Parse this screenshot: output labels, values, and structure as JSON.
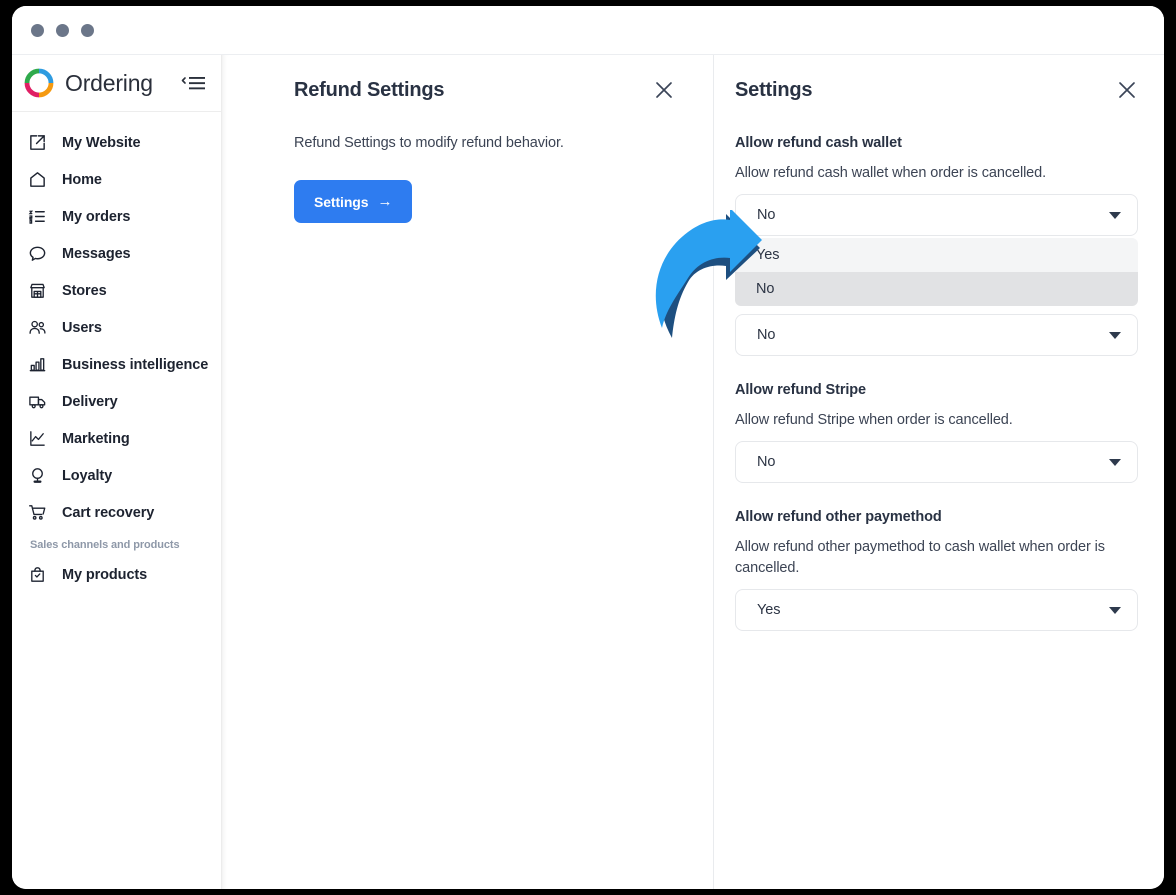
{
  "window": {
    "traffic_dots": [
      "dot-1",
      "dot-2",
      "dot-3"
    ]
  },
  "sidebar": {
    "brand": "Ordering",
    "logo_icon": "ordering-ring-logo",
    "logo_colors": [
      "#2faa4c",
      "#2e9be0",
      "#f59a11",
      "#e01f64"
    ],
    "collapse_icon": "collapse-sidebar-icon",
    "items": [
      {
        "label": "My Website",
        "icon": "external-link-icon"
      },
      {
        "label": "Home",
        "icon": "home-icon"
      },
      {
        "label": "My orders",
        "icon": "ordered-list-icon"
      },
      {
        "label": "Messages",
        "icon": "chat-bubble-icon"
      },
      {
        "label": "Stores",
        "icon": "store-icon"
      },
      {
        "label": "Users",
        "icon": "users-icon"
      },
      {
        "label": "Business intelligence",
        "icon": "bar-chart-icon"
      },
      {
        "label": "Delivery",
        "icon": "truck-icon"
      },
      {
        "label": "Marketing",
        "icon": "line-chart-icon"
      },
      {
        "label": "Loyalty",
        "icon": "medal-icon"
      },
      {
        "label": "Cart recovery",
        "icon": "shopping-cart-icon"
      }
    ],
    "group_label": "Sales channels and products",
    "group_items": [
      {
        "label": "My products",
        "icon": "bag-check-icon"
      }
    ]
  },
  "main_panel": {
    "title": "Refund Settings",
    "close_icon": "close-icon",
    "description": "Refund Settings to modify refund behavior.",
    "button_label": "Settings",
    "button_arrow": "→"
  },
  "settings_panel": {
    "title": "Settings",
    "close_icon": "close-icon",
    "accent_color": "#2e7cf0",
    "sections": [
      {
        "title": "Allow refund cash wallet",
        "description": "Allow refund cash wallet when order is cancelled.",
        "value": "No",
        "open": true,
        "options": [
          {
            "label": "Yes",
            "state": "light"
          },
          {
            "label": "No",
            "state": "highlighted"
          }
        ]
      },
      {
        "title": "",
        "description": "",
        "value": "No",
        "open": false,
        "options": []
      },
      {
        "title": "Allow refund Stripe",
        "description": "Allow refund Stripe when order is cancelled.",
        "value": "No",
        "open": false,
        "options": []
      },
      {
        "title": "Allow refund other paymethod",
        "description": "Allow refund other paymethod to cash wallet when order is cancelled.",
        "value": "Yes",
        "open": false,
        "options": []
      }
    ]
  },
  "annotation": {
    "icon": "curved-arrow-annotation",
    "color": "#2aa0f0",
    "shadow_color": "#1d4f80"
  }
}
